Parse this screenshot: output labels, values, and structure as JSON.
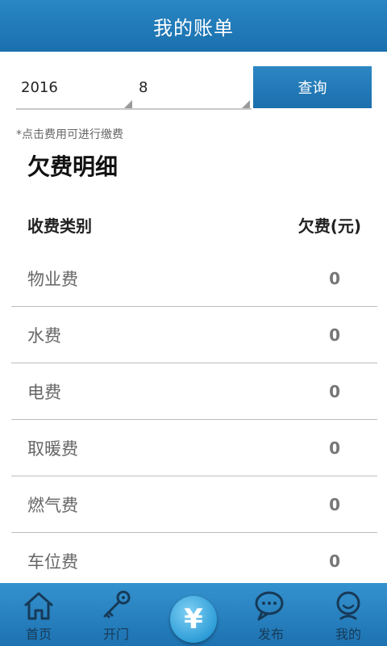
{
  "header": {
    "title": "我的账单"
  },
  "filters": {
    "year": "2016",
    "month": "8",
    "query_label": "查询"
  },
  "hint": "*点击费用可进行缴费",
  "section_title": "欠费明细",
  "table": {
    "col_category": "收费类别",
    "col_amount": "欠费(元)",
    "rows": [
      {
        "label": "物业费",
        "value": "0"
      },
      {
        "label": "水费",
        "value": "0"
      },
      {
        "label": "电费",
        "value": "0"
      },
      {
        "label": "取暖费",
        "value": "0"
      },
      {
        "label": "燃气费",
        "value": "0"
      },
      {
        "label": "车位费",
        "value": "0"
      }
    ]
  },
  "tabbar": {
    "home": "首页",
    "open_door": "开门",
    "center_symbol": "¥",
    "publish": "发布",
    "mine": "我的"
  },
  "colors": {
    "primary": "#1b6fad",
    "tab_text": "#163a58"
  }
}
